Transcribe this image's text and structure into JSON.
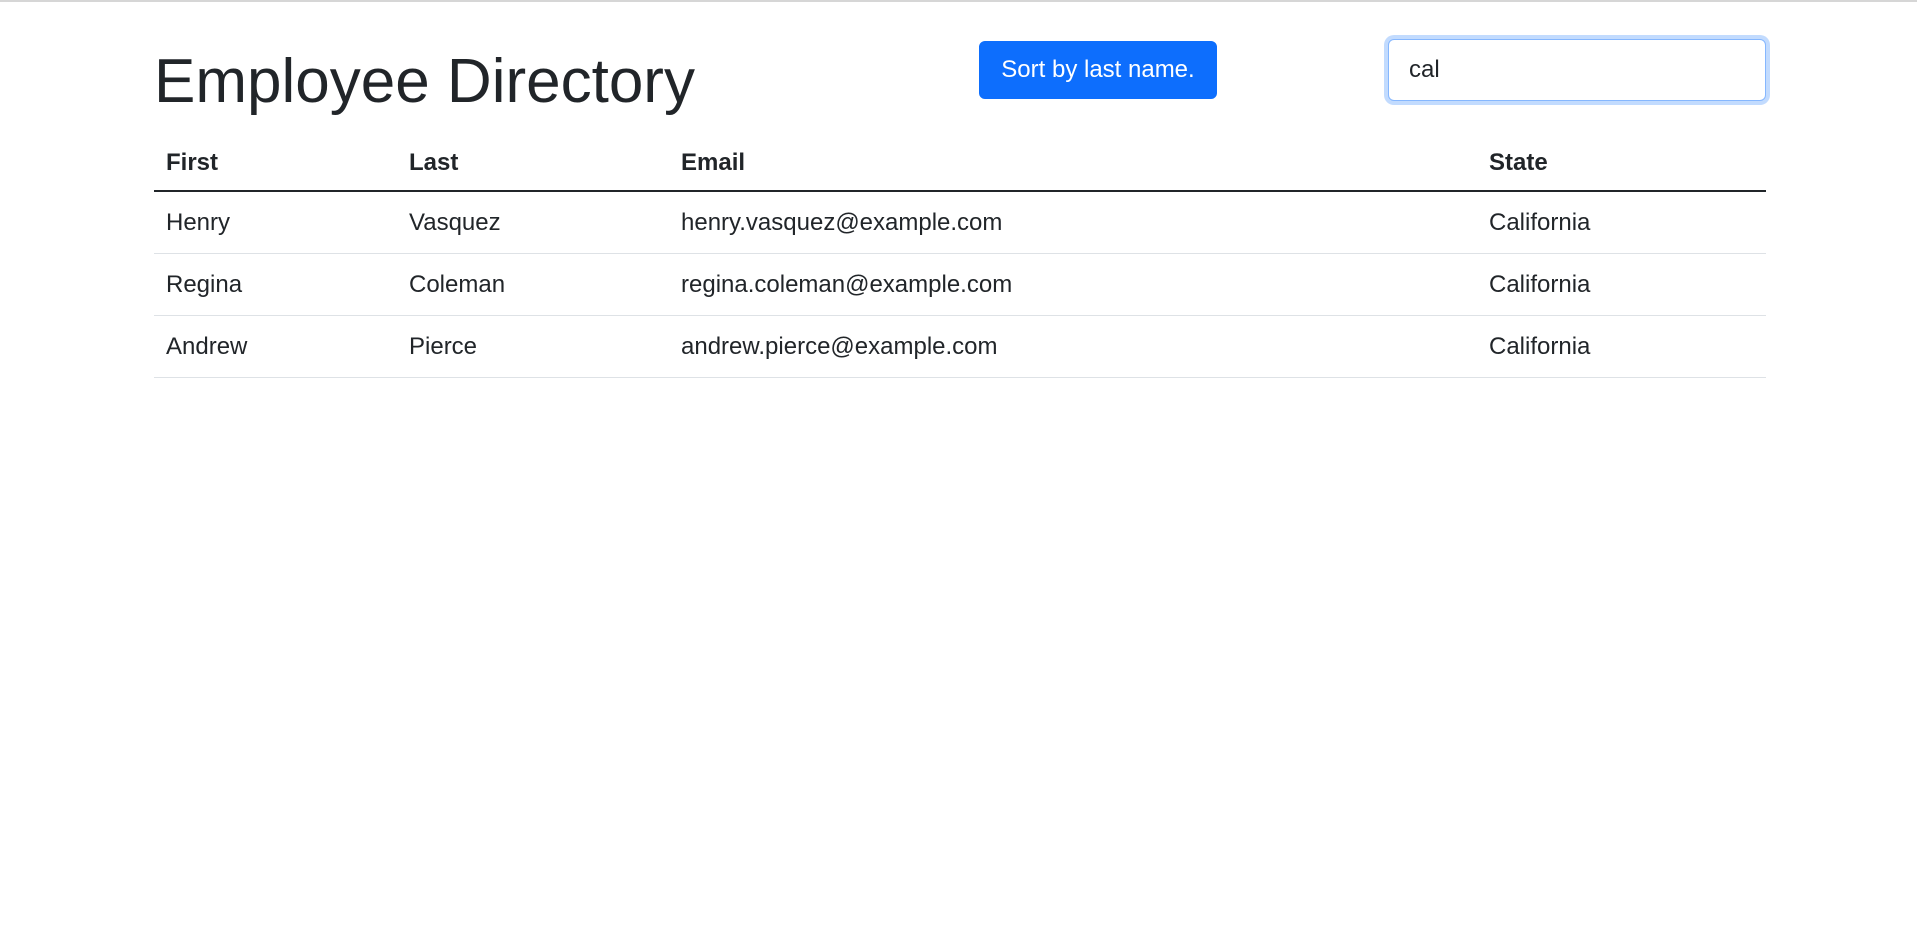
{
  "header": {
    "title": "Employee Directory",
    "sort_button_label": "Sort by last name."
  },
  "search": {
    "value": "cal",
    "placeholder": ""
  },
  "table": {
    "columns": [
      "First",
      "Last",
      "Email",
      "State"
    ],
    "rows": [
      {
        "first": "Henry",
        "last": "Vasquez",
        "email": "henry.vasquez@example.com",
        "state": "California"
      },
      {
        "first": "Regina",
        "last": "Coleman",
        "email": "regina.coleman@example.com",
        "state": "California"
      },
      {
        "first": "Andrew",
        "last": "Pierce",
        "email": "andrew.pierce@example.com",
        "state": "California"
      }
    ]
  },
  "colors": {
    "accent": "#0d6efd",
    "text": "#212529",
    "row_border": "#dee2e6"
  }
}
